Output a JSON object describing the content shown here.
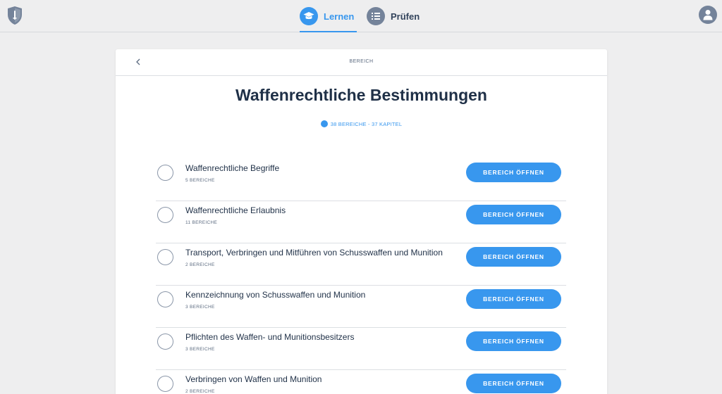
{
  "nav": {
    "tabs": [
      {
        "label": "Lernen",
        "icon": "graduation-cap-icon",
        "active": true
      },
      {
        "label": "Prüfen",
        "icon": "list-icon",
        "active": false
      }
    ],
    "logo_icon": "shield-icon",
    "avatar_icon": "user-icon"
  },
  "header": {
    "title": "BEREICH",
    "back_icon": "chevron-left-icon"
  },
  "page": {
    "title": "Waffenrechtliche Bestimmungen",
    "meta": "38 BEREICHE - 37 KAPITEL"
  },
  "sections": [
    {
      "title": "Waffenrechtliche Begriffe",
      "sub": "5 BEREICHE",
      "button": "BEREICH ÖFFNEN"
    },
    {
      "title": "Waffenrechtliche Erlaubnis",
      "sub": "11 BEREICHE",
      "button": "BEREICH ÖFFNEN"
    },
    {
      "title": "Transport, Verbringen und Mitführen von Schusswaffen und Munition",
      "sub": "2 BEREICHE",
      "button": "BEREICH ÖFFNEN"
    },
    {
      "title": "Kennzeichnung von Schusswaffen und Munition",
      "sub": "3 BEREICHE",
      "button": "BEREICH ÖFFNEN"
    },
    {
      "title": "Pflichten des Waffen- und Munitionsbesitzers",
      "sub": "3 BEREICHE",
      "button": "BEREICH ÖFFNEN"
    },
    {
      "title": "Verbringen von Waffen und Munition",
      "sub": "2 BEREICHE",
      "button": "BEREICH ÖFFNEN"
    }
  ],
  "colors": {
    "accent": "#3897ee",
    "text": "#1f3047",
    "muted": "#5c6b80",
    "inactive_icon": "#74839a",
    "background": "#eeeeef"
  }
}
